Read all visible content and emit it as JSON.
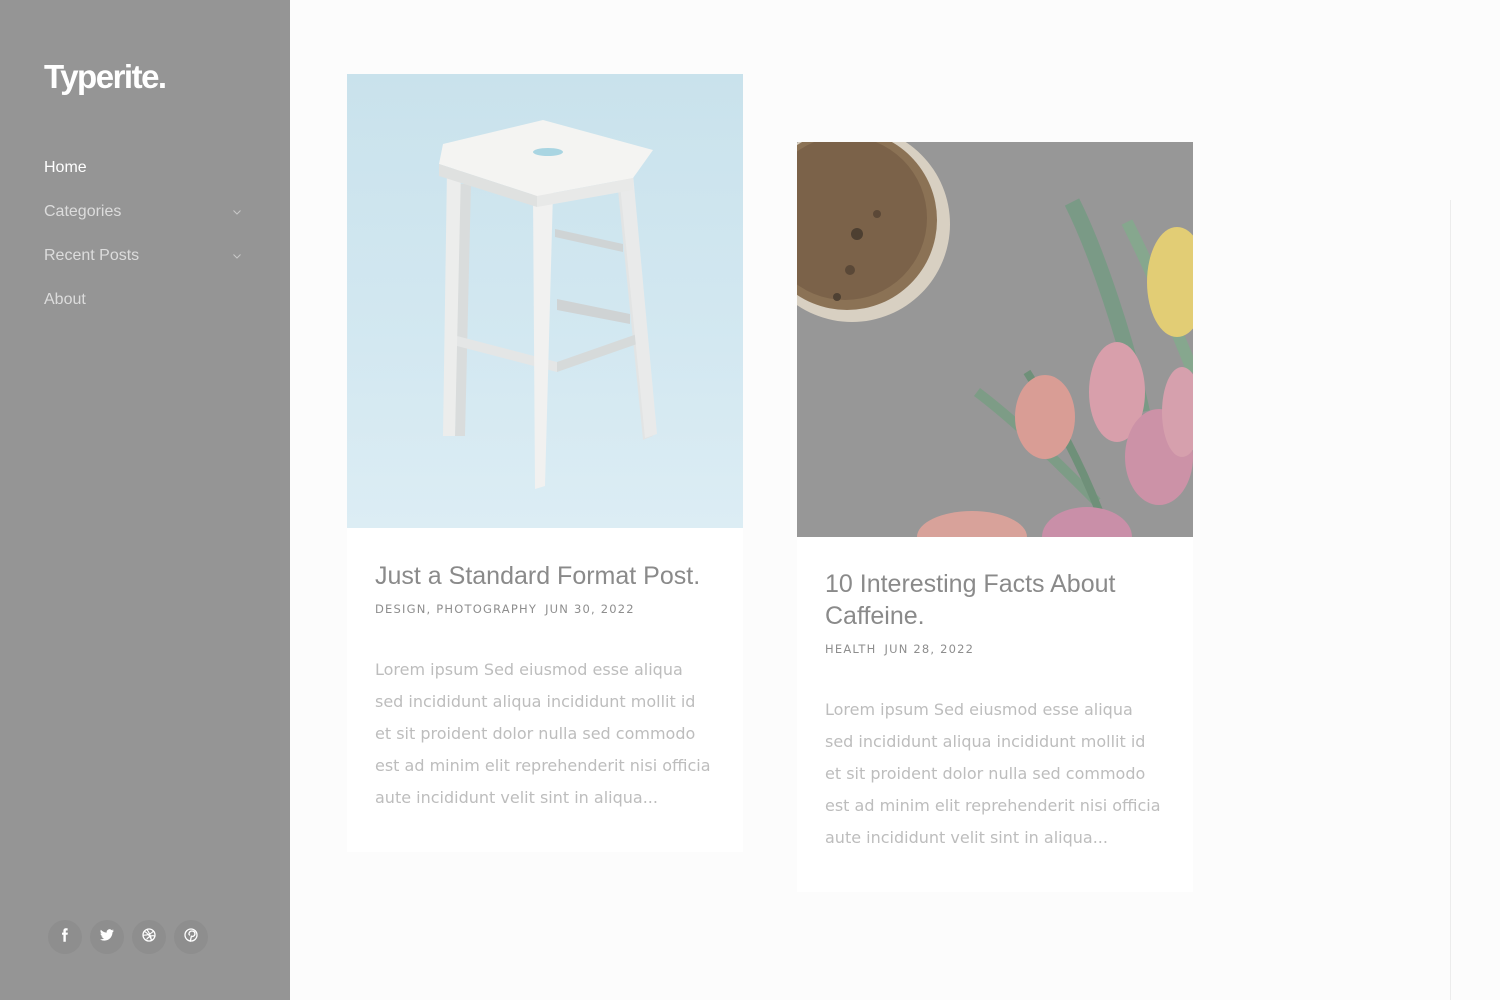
{
  "site": {
    "logo": "Typerite."
  },
  "nav": {
    "items": [
      {
        "label": "Home",
        "active": true,
        "has_submenu": false
      },
      {
        "label": "Categories",
        "active": false,
        "has_submenu": true
      },
      {
        "label": "Recent Posts",
        "active": false,
        "has_submenu": true
      },
      {
        "label": "About",
        "active": false,
        "has_submenu": false
      }
    ]
  },
  "social": [
    {
      "icon": "facebook-icon"
    },
    {
      "icon": "twitter-icon"
    },
    {
      "icon": "dribbble-icon"
    },
    {
      "icon": "pinterest-icon"
    }
  ],
  "posts": [
    {
      "title": "Just a Standard Format Post.",
      "category_1": "Design",
      "category_2": "Photography",
      "date": "Jun 30, 2022",
      "excerpt": "Lorem ipsum Sed eiusmod esse aliqua sed incididunt aliqua incididunt mollit id et sit proident dolor nulla sed commodo est ad minim elit reprehenderit nisi officia aute incididunt velit sint in aliqua...",
      "image": "white-wooden-stool-on-light-blue-background"
    },
    {
      "title": "10 Interesting Facts About Caffeine.",
      "category_1": "Health",
      "date": "Jun 28, 2022",
      "excerpt": "Lorem ipsum Sed eiusmod esse aliqua sed incididunt aliqua incididunt mollit id et sit proident dolor nulla sed commodo est ad minim elit reprehenderit nisi officia aute incididunt velit sint in aliqua...",
      "image": "coffee-cup-and-pink-tulips-on-dark-background"
    }
  ],
  "colors": {
    "sidebar_bg": "#959595",
    "page_bg": "#fcfcfc",
    "card_bg": "#ffffff",
    "title_text": "#8a8a8a",
    "excerpt_text": "#bdbdbd"
  }
}
